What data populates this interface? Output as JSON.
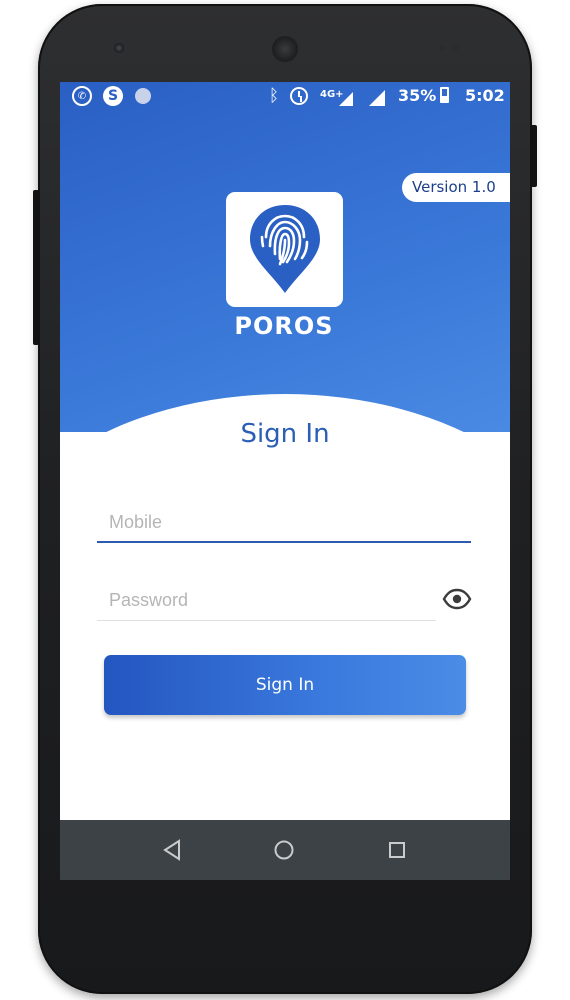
{
  "status_bar": {
    "network": "4G+",
    "battery": "35%",
    "time": "5:02",
    "icons": [
      "whatsapp-icon",
      "skype-icon",
      "notification-dot-icon",
      "bluetooth-icon",
      "alarm-icon",
      "cell-signal-icon",
      "wifi-signal-icon",
      "battery-icon"
    ]
  },
  "header": {
    "version": "Version 1.0",
    "brand": "POROS",
    "logo_icon": "fingerprint-pin-icon"
  },
  "form": {
    "title": "Sign In",
    "mobile_placeholder": "Mobile",
    "password_placeholder": "Password",
    "toggle_icon": "eye-icon",
    "submit_label": "Sign In"
  },
  "nav": {
    "back_icon": "back-triangle-icon",
    "home_icon": "home-circle-icon",
    "recent_icon": "recents-square-icon"
  },
  "colors": {
    "primary": "#2d62c4",
    "accent_text": "#2a5fb5",
    "navbar": "#3d4246"
  }
}
